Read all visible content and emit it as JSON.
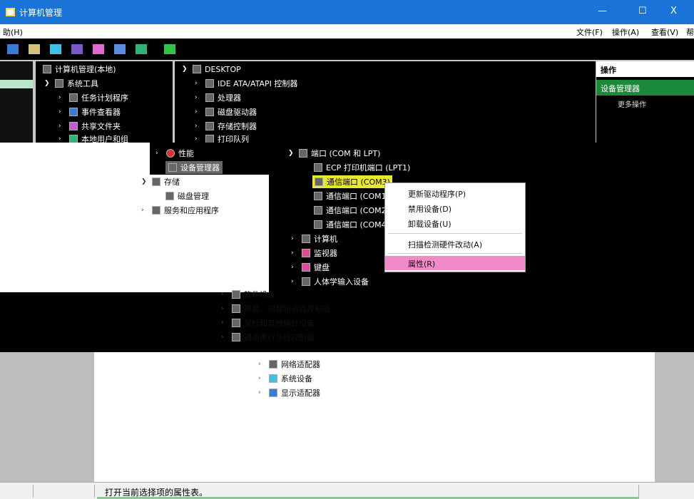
{
  "window": {
    "title": "计算机管理",
    "controls": {
      "minimize": "—",
      "maximize": "☐",
      "close": "X"
    }
  },
  "menubar": {
    "left_item": "助(H)",
    "items": [
      "文件(F)",
      "操作(A)",
      "查看(V)",
      "帮"
    ]
  },
  "left_tree": {
    "root": "计算机管理(本地)",
    "system_tools": "系统工具",
    "items": [
      "任务计划程序",
      "事件查看器",
      "共享文件夹",
      "本地用户和组"
    ],
    "lower_items": [
      "性能",
      "设备管理器"
    ],
    "storage": "存储",
    "storage_child": "磁盘管理",
    "services": "服务和应用程序"
  },
  "device_tree": {
    "root": "DESKTOP",
    "categories": [
      "IDE ATA/ATAPI 控制器",
      "处理器",
      "磁盘驱动器",
      "存储控制器",
      "打印队列"
    ],
    "ports_node": "端口 (COM 和 LPT)",
    "ports": [
      "ECP 打印机端口 (LPT1)",
      "通信端口 (COM3)",
      "通信端口 (COM1)",
      "通信端口 (COM2)",
      "通信端口 (COM4)"
    ],
    "more_categories": [
      "计算机",
      "监视器",
      "键盘",
      "人体学输入设备",
      "软件设备",
      "声音、视频和游戏控制器",
      "鼠标和其他指针设备",
      "通用串行总线控制器",
      "网络适配器",
      "系统设备",
      "显示适配器"
    ]
  },
  "actions_panel": {
    "header": "操作",
    "section": "设备管理器",
    "more": "更多操作"
  },
  "context_menu": {
    "items": [
      "更新驱动程序(P)",
      "禁用设备(D)",
      "卸载设备(U)",
      "扫描检测硬件改动(A)",
      "属性(R)"
    ],
    "highlighted": "属性(R)"
  },
  "statusbar": {
    "text": "打开当前选择项的属性表。"
  },
  "colors": {
    "titlebar": "#1a74d8",
    "highlight": "#f08bc7",
    "selected_row": "#e8e830",
    "actions_section": "#1a8a3a"
  }
}
